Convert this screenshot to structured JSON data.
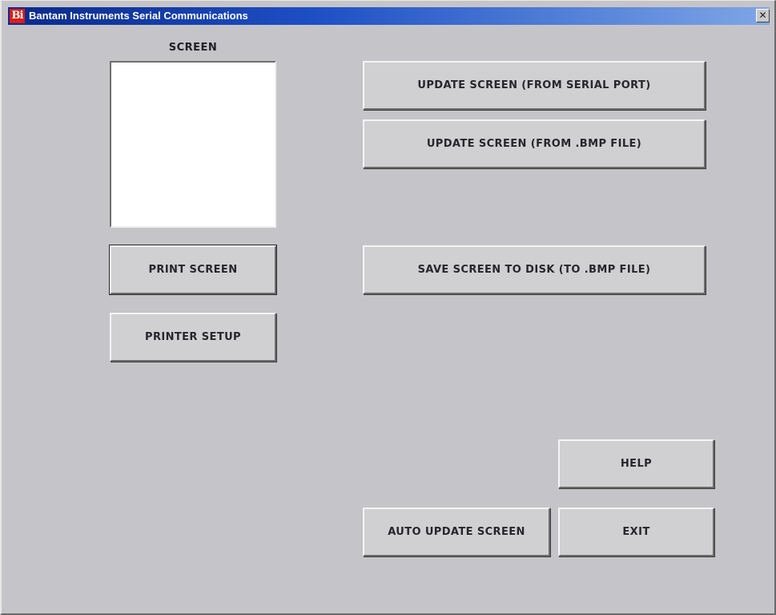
{
  "window": {
    "icon_text": "Bi",
    "title": "Bantam Instruments Serial Communications",
    "close_glyph": "✕"
  },
  "screen": {
    "label": "SCREEN"
  },
  "buttons": {
    "update_serial": "UPDATE SCREEN  (FROM SERIAL PORT)",
    "update_bmp": "UPDATE SCREEN  (FROM .BMP FILE)",
    "print_screen": "PRINT SCREEN",
    "save_screen": "SAVE SCREEN TO DISK (TO .BMP FILE)",
    "printer_setup": "PRINTER  SETUP",
    "help": "HELP",
    "auto_update": "AUTO UPDATE SCREEN",
    "exit": "EXIT"
  },
  "colors": {
    "title_start": "#0a2a8a",
    "title_end": "#7ea6e6",
    "app_icon": "#d81e1e",
    "face": "#c5c5c9"
  }
}
